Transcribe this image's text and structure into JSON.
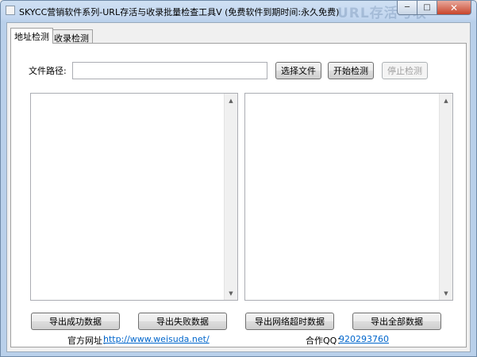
{
  "window": {
    "title": "SKYCC营销软件系列-URL存活与收录批量检查工具V (免费软件到期时间:永久免费)",
    "title_ghost": "URL存活与收",
    "caption": {
      "minimize": "─",
      "maximize": "□",
      "close": "✕"
    }
  },
  "tabs": [
    {
      "label": "地址检测",
      "active": true
    },
    {
      "label": "收录检测",
      "active": false
    }
  ],
  "form": {
    "path_label": "文件路径:",
    "path_value": "",
    "choose_file": "选择文件",
    "start_check": "开始检测",
    "stop_check": "停止检测"
  },
  "lists": {
    "left_items": [],
    "right_items": []
  },
  "scroll_arrows": {
    "up": "▲",
    "down": "▼"
  },
  "export": {
    "success": "导出成功数据",
    "failure": "导出失败数据",
    "timeout": "导出网络超时数据",
    "all": "导出全部数据"
  },
  "footer": {
    "site_label": "官方网址：",
    "site_url": "http://www.weisuda.net/",
    "qq_label": "合作QQ：",
    "qq_number": "920293760"
  },
  "colors": {
    "link": "#0066cc",
    "close_button": "#c8452c",
    "title_bar": "#c2d6ef"
  }
}
